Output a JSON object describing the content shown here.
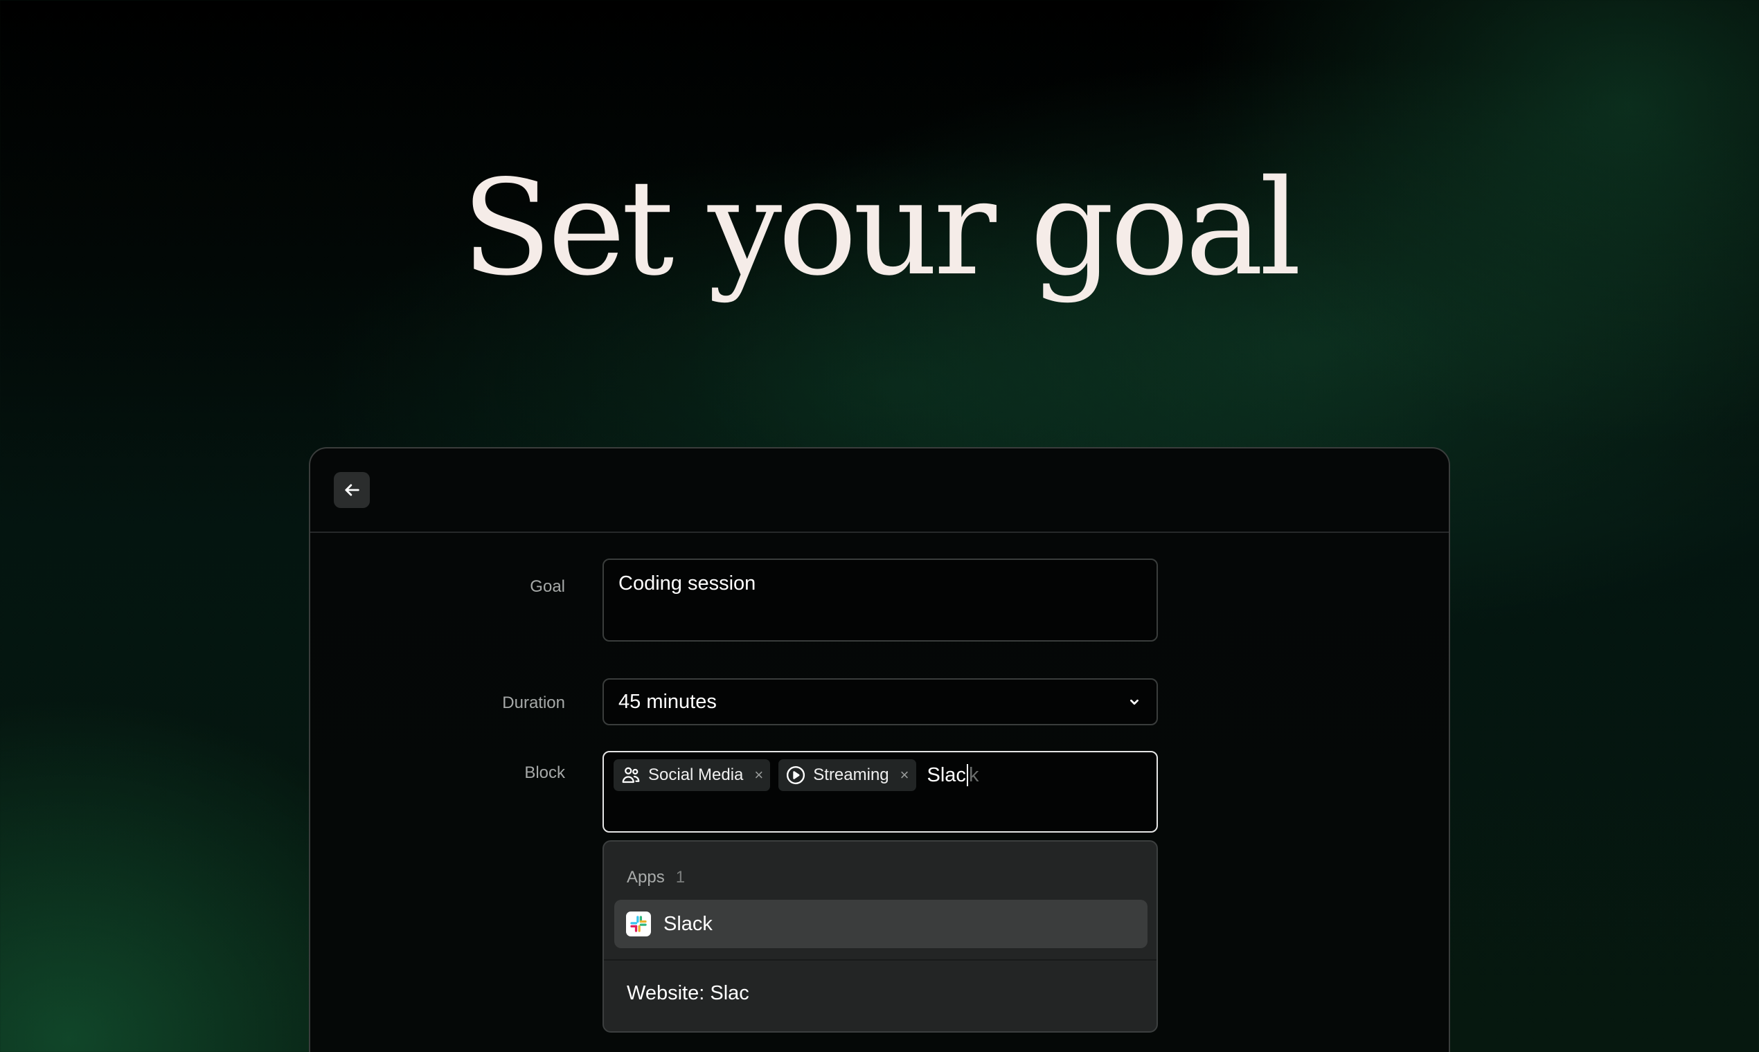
{
  "page": {
    "headline": "Set your goal"
  },
  "form": {
    "goal": {
      "label": "Goal",
      "value": "Coding session"
    },
    "duration": {
      "label": "Duration",
      "value": "45 minutes"
    },
    "block": {
      "label": "Block",
      "chips": [
        {
          "label": "Social Media",
          "icon": "people-icon"
        },
        {
          "label": "Streaming",
          "icon": "play-circle-icon"
        }
      ],
      "typed_text": "Slac",
      "autocomplete_suffix": "k"
    }
  },
  "dropdown": {
    "section_title": "Apps",
    "section_count": "1",
    "app_item": {
      "label": "Slack",
      "icon": "slack-logo"
    },
    "website_item": "Website: Slac"
  },
  "colors": {
    "background": "#000000",
    "accent_green": "#0b3a22",
    "headline_text": "#f5ece8",
    "panel_border": "#3a3d3c",
    "dropdown_bg": "#232525",
    "highlight_bg": "#3b3d3d"
  }
}
